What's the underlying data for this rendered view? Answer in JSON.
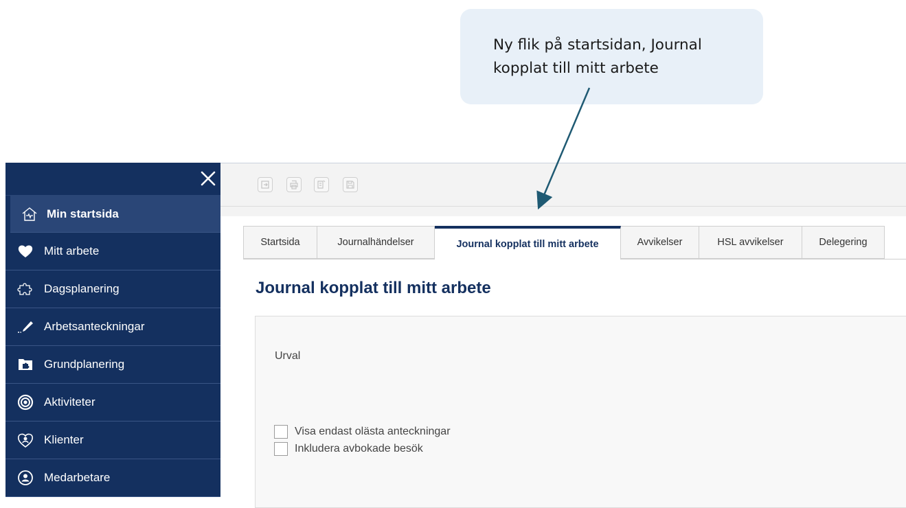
{
  "callout": {
    "text": "Ny flik på startsidan, Journal kopplat till mitt arbete"
  },
  "sidebar": {
    "items": [
      {
        "label": "Min startsida",
        "icon": "home-heart-icon",
        "active": true
      },
      {
        "label": "Mitt arbete",
        "icon": "heart-icon"
      },
      {
        "label": "Dagsplanering",
        "icon": "puzzle-icon"
      },
      {
        "label": "Arbetsanteckningar",
        "icon": "pen-icon"
      },
      {
        "label": "Grundplanering",
        "icon": "folder-puzzle-icon"
      },
      {
        "label": "Aktiviteter",
        "icon": "target-icon"
      },
      {
        "label": "Klienter",
        "icon": "heart-person-icon"
      },
      {
        "label": "Medarbetare",
        "icon": "person-circle-icon"
      }
    ]
  },
  "toolbar": {
    "buttons": [
      "export-icon",
      "print-icon",
      "edit-document-icon",
      "save-icon"
    ]
  },
  "tabs": [
    {
      "label": "Startsida"
    },
    {
      "label": "Journalhändelser"
    },
    {
      "label": "Journal kopplat till mitt arbete",
      "active": true
    },
    {
      "label": "Avvikelser"
    },
    {
      "label": "HSL avvikelser"
    },
    {
      "label": "Delegering"
    }
  ],
  "main": {
    "title": "Journal kopplat till mitt arbete",
    "urval_label": "Urval",
    "checkboxes": [
      {
        "label": "Visa endast olästa anteckningar",
        "checked": false
      },
      {
        "label": "Inkludera avbokade besök",
        "checked": false
      }
    ]
  },
  "colors": {
    "navy": "#14305f",
    "callout_bg": "#e8f0f8",
    "arrow": "#1f5a73"
  }
}
